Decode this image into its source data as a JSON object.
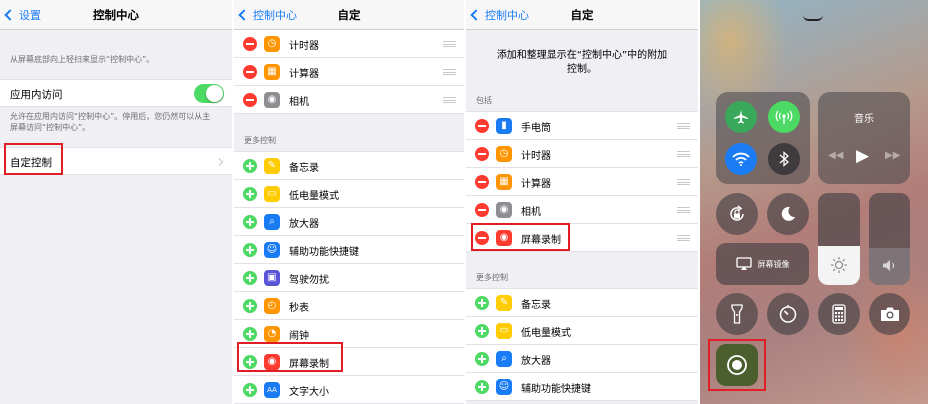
{
  "panel1": {
    "back": "设置",
    "title": "控制中心",
    "top_note": "从屏幕底部向上轻扫来显示“控制中心”。",
    "access_label": "应用内访问",
    "access_note_1": "允许在应用内访问“控制中心”。停用后，您仍然可以从主",
    "access_note_2": "屏幕访问“控制中心”。",
    "customize": "自定控制"
  },
  "panel2": {
    "back": "控制中心",
    "title": "自定",
    "included": [
      {
        "label": "计时器",
        "icon": "timer-icon",
        "color": "#ff9500"
      },
      {
        "label": "计算器",
        "icon": "calculator-icon",
        "color": "#ff9500"
      },
      {
        "label": "相机",
        "icon": "camera-icon",
        "color": "#8e8e93"
      }
    ],
    "more_header": "更多控制",
    "more": [
      {
        "label": "备忘录",
        "icon": "notes-icon",
        "color": "#ffcc00"
      },
      {
        "label": "低电量模式",
        "icon": "battery-icon",
        "color": "#ffcc00"
      },
      {
        "label": "放大器",
        "icon": "magnifier-icon",
        "color": "#1a7cf5"
      },
      {
        "label": "辅助功能快捷键",
        "icon": "accessibility-icon",
        "color": "#1a7cf5"
      },
      {
        "label": "驾驶勿扰",
        "icon": "car-icon",
        "color": "#5856d6"
      },
      {
        "label": "秒表",
        "icon": "stopwatch-icon",
        "color": "#ff9500"
      },
      {
        "label": "闹钟",
        "icon": "alarm-icon",
        "color": "#ff9500"
      },
      {
        "label": "屏幕录制",
        "icon": "screen-record-icon",
        "color": "#ff3b30"
      },
      {
        "label": "文字大小",
        "icon": "text-size-icon",
        "color": "#1a7cf5"
      }
    ]
  },
  "panel3": {
    "back": "控制中心",
    "title": "自定",
    "intro_1": "添加和整理显示在“控制中心”中的附加",
    "intro_2": "控制。",
    "included_header": "包括",
    "included": [
      {
        "label": "手电筒",
        "icon": "flashlight-icon",
        "color": "#1a7cf5"
      },
      {
        "label": "计时器",
        "icon": "timer-icon",
        "color": "#ff9500"
      },
      {
        "label": "计算器",
        "icon": "calculator-icon",
        "color": "#ff9500"
      },
      {
        "label": "相机",
        "icon": "camera-icon",
        "color": "#8e8e93"
      },
      {
        "label": "屏幕录制",
        "icon": "screen-record-icon",
        "color": "#ff3b30"
      }
    ],
    "more_header": "更多控制",
    "more": [
      {
        "label": "备忘录",
        "icon": "notes-icon",
        "color": "#ffcc00"
      },
      {
        "label": "低电量模式",
        "icon": "battery-icon",
        "color": "#ffcc00"
      },
      {
        "label": "放大器",
        "icon": "magnifier-icon",
        "color": "#1a7cf5"
      },
      {
        "label": "辅助功能快捷键",
        "icon": "accessibility-icon",
        "color": "#1a7cf5"
      }
    ]
  },
  "panel4": {
    "music_label": "音乐",
    "mirror_label": "屏幕镜像"
  },
  "colors": {
    "accent": "#1a7cf5",
    "highlight": "#e11d26",
    "toggle_on": "#4cd964"
  }
}
